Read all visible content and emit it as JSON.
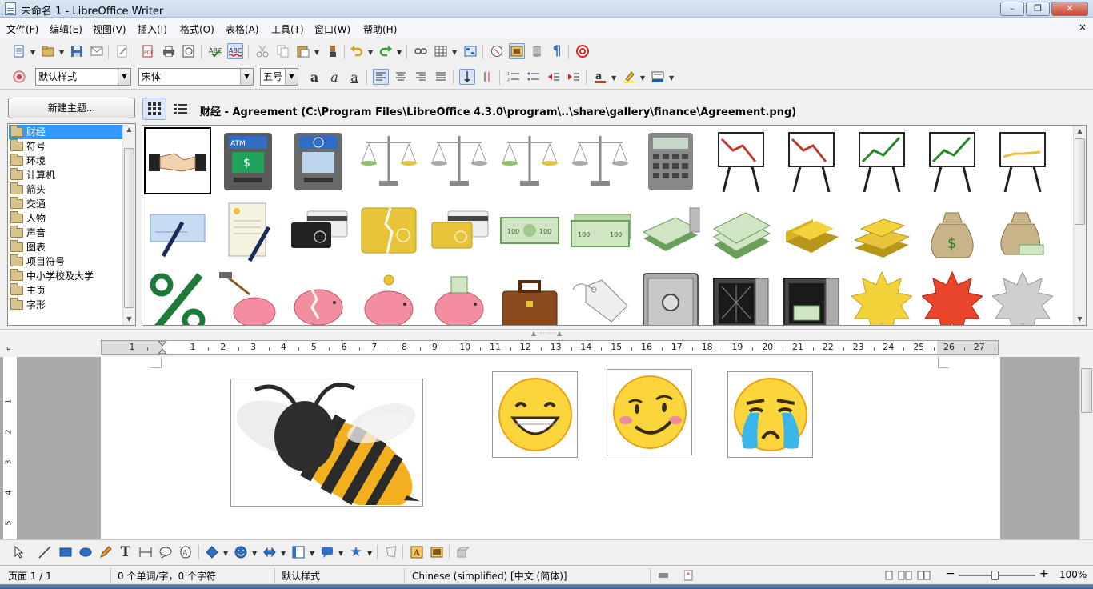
{
  "window": {
    "title": "未命名 1 - LibreOffice Writer",
    "controls": {
      "minimize": "–",
      "maximize": "❐",
      "close": "✕"
    }
  },
  "menubar": {
    "items": [
      "文件(F)",
      "编辑(E)",
      "视图(V)",
      "插入(I)",
      "格式(O)",
      "表格(A)",
      "工具(T)",
      "窗口(W)",
      "帮助(H)"
    ],
    "doc_close": "×"
  },
  "formatting": {
    "paragraph_style": "默认样式",
    "font_name": "宋体",
    "font_size": "五号"
  },
  "gallery": {
    "new_theme_button": "新建主题...",
    "themes": [
      {
        "label": "财经",
        "selected": true
      },
      {
        "label": "符号"
      },
      {
        "label": "环境"
      },
      {
        "label": "计算机"
      },
      {
        "label": "箭头"
      },
      {
        "label": "交通"
      },
      {
        "label": "人物"
      },
      {
        "label": "声音"
      },
      {
        "label": "图表"
      },
      {
        "label": "项目符号"
      },
      {
        "label": "中小学校及大学"
      },
      {
        "label": "主页"
      },
      {
        "label": "字形"
      }
    ],
    "path_text": "财经 - Agreement (C:\\Program Files\\LibreOffice 4.3.0\\program\\..\\share\\gallery\\finance\\Agreement.png)",
    "items": [
      "handshake",
      "atm-blue",
      "atm-gray",
      "scales-gold",
      "scales-silver",
      "scales-gold-2",
      "scales-silver-2",
      "calculator",
      "chart-board-down",
      "chart-board-down-2",
      "chart-board-up",
      "chart-board-up-2",
      "chart-board-flat",
      "cheque-pen",
      "contract-pen",
      "credit-card-black",
      "broken-card-gold",
      "card-gold",
      "banknote",
      "banknotes",
      "banknote-stack-coins",
      "banknote-stack",
      "gold-bar",
      "gold-bars",
      "money-bag",
      "money-bag-coins",
      "percent",
      "piggy-hammer",
      "piggy-broken",
      "piggy-coin",
      "piggy-cash",
      "briefcase",
      "price-tag",
      "safe-closed",
      "safe-empty",
      "safe-money",
      "starburst-yellow",
      "starburst-red",
      "starburst-gray"
    ]
  },
  "ruler": {
    "labels": [
      "1",
      "1",
      "2",
      "3",
      "4",
      "5",
      "6",
      "7",
      "8",
      "9",
      "10",
      "11",
      "12",
      "13",
      "14",
      "15",
      "16",
      "17",
      "18",
      "19",
      "20",
      "21",
      "22",
      "23",
      "24",
      "25",
      "26",
      "27"
    ],
    "vlabels": [
      "1",
      "2",
      "3",
      "4",
      "5"
    ]
  },
  "statusbar": {
    "page": "页面 1 / 1",
    "word_count": "0 个单词/字，0 个字符",
    "page_style": "默认样式",
    "language": "Chinese (simplified) [中文 (简体)]",
    "zoom": "100%"
  },
  "colors": {
    "selection": "#3399ff",
    "titlebar": "#dbe6f4",
    "document_bg": "#a9a9a9"
  }
}
